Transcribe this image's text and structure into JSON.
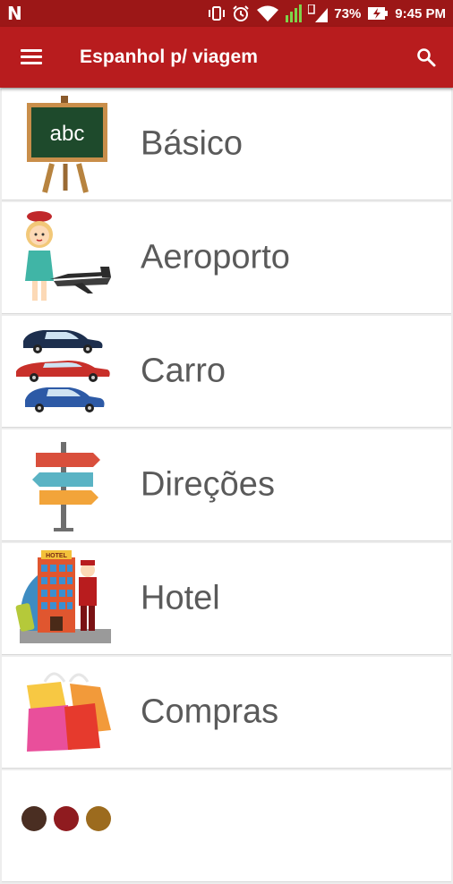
{
  "status_bar": {
    "battery": "73%",
    "time": "9:45 PM"
  },
  "app_bar": {
    "title": "Espanhol p/ viagem"
  },
  "icons": {
    "menu": "hamburger-menu-icon",
    "search": "magnifier-search-icon"
  },
  "categories": [
    {
      "label": "Básico",
      "icon": "chalkboard-abc-icon",
      "board_text": "abc"
    },
    {
      "label": "Aeroporto",
      "icon": "flight-attendant-airplane-icon"
    },
    {
      "label": "Carro",
      "icon": "cars-icon"
    },
    {
      "label": "Direções",
      "icon": "signpost-icon"
    },
    {
      "label": "Hotel",
      "icon": "hotel-bellhop-icon",
      "sign_text": "HOTEL"
    },
    {
      "label": "Compras",
      "icon": "shopping-bags-icon"
    },
    {
      "label": "",
      "icon": "food-plates-icon"
    }
  ],
  "colors": {
    "status_bar": "#9c1717",
    "app_bar": "#b81c1e",
    "card": "#ffffff",
    "label_text": "#5a5a5a"
  }
}
